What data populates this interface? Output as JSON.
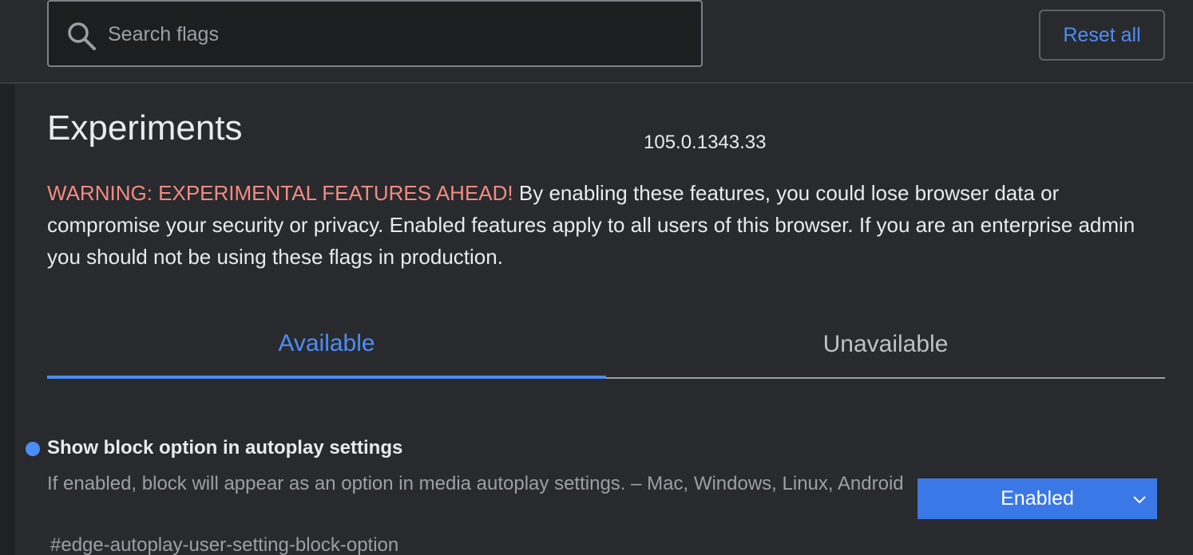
{
  "header": {
    "search_placeholder": "Search flags",
    "reset_label": "Reset all"
  },
  "main": {
    "title": "Experiments",
    "version": "105.0.1343.33",
    "warning_strong": "WARNING: EXPERIMENTAL FEATURES AHEAD!",
    "warning_text": " By enabling these features, you could lose browser data or compromise your security or privacy. Enabled features apply to all users of this browser. If you are an enterprise admin you should not be using these flags in production."
  },
  "tabs": [
    {
      "label": "Available",
      "active": true
    },
    {
      "label": "Unavailable",
      "active": false
    }
  ],
  "experiment": {
    "title": "Show block option in autoplay settings",
    "description": "If enabled, block will appear as an option in media autoplay settings. – Mac, Windows, Linux, Android",
    "link": "#edge-autoplay-user-setting-block-option",
    "selected_value": "Enabled"
  },
  "colors": {
    "background": "#292a2d",
    "accent": "#4c8df6",
    "warning": "#f28b82",
    "select_bg": "#3b78e7"
  },
  "icons": {
    "search": "search-icon",
    "dropdown": "chevron-down-icon"
  }
}
